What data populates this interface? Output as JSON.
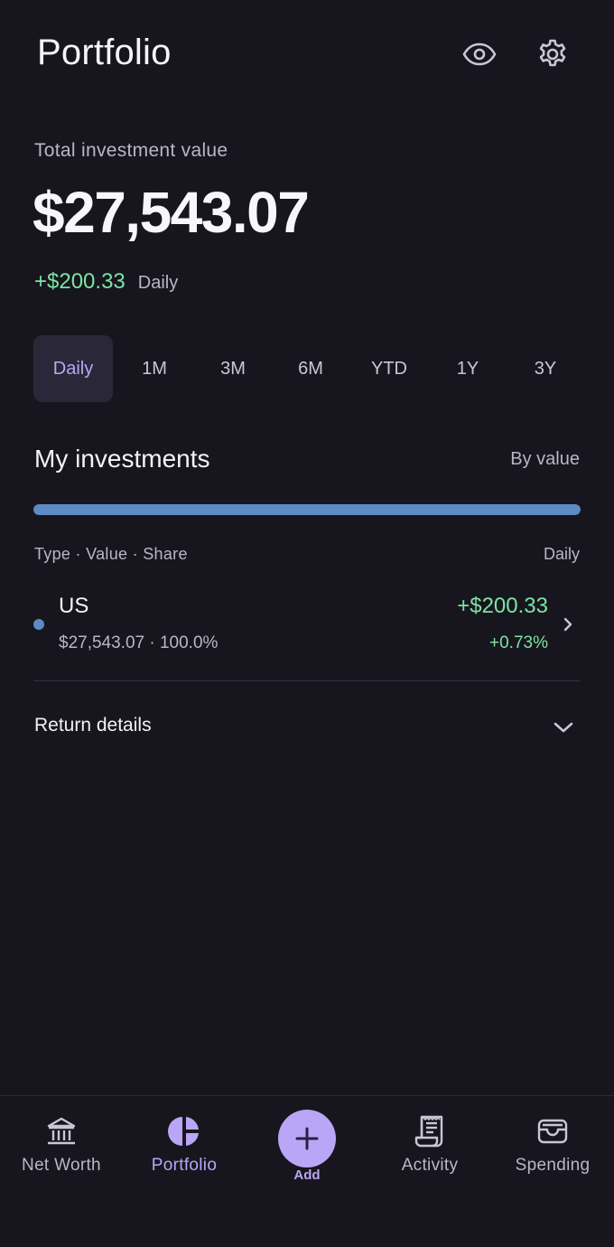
{
  "header": {
    "title": "Portfolio",
    "icons": [
      "eye-icon",
      "gear-icon"
    ]
  },
  "summary": {
    "label": "Total investment value",
    "value": "$27,543.07",
    "change": "+$200.33",
    "change_period": "Daily"
  },
  "range_tabs": [
    {
      "label": "Daily",
      "active": true
    },
    {
      "label": "1M",
      "active": false
    },
    {
      "label": "3M",
      "active": false
    },
    {
      "label": "6M",
      "active": false
    },
    {
      "label": "YTD",
      "active": false
    },
    {
      "label": "1Y",
      "active": false
    },
    {
      "label": "3Y",
      "active": false
    }
  ],
  "investments": {
    "title": "My investments",
    "sort_label": "By value",
    "allocation_share": 1.0,
    "columns_left": "Type · Value · Share",
    "columns_right": "Daily",
    "items": [
      {
        "name": "US",
        "subtitle": "$27,543.07 · 100.0%",
        "change": "+$200.33",
        "change_pct": "+0.73%",
        "color": "#5e8ac4"
      }
    ],
    "return_details_label": "Return details"
  },
  "bottom_nav": [
    {
      "label": "Net Worth",
      "icon": "bank-icon",
      "active": false
    },
    {
      "label": "Portfolio",
      "icon": "pie-chart-icon",
      "active": true
    },
    {
      "label": "Add",
      "icon": "plus-icon",
      "active": false
    },
    {
      "label": "Activity",
      "icon": "receipt-icon",
      "active": false
    },
    {
      "label": "Spending",
      "icon": "wallet-icon",
      "active": false
    }
  ],
  "colors": {
    "background": "#17161e",
    "accent": "#b9a6f7",
    "positive": "#7ee3a4",
    "muted_text": "#b9b7c4",
    "allocation": "#5e8ac4"
  }
}
